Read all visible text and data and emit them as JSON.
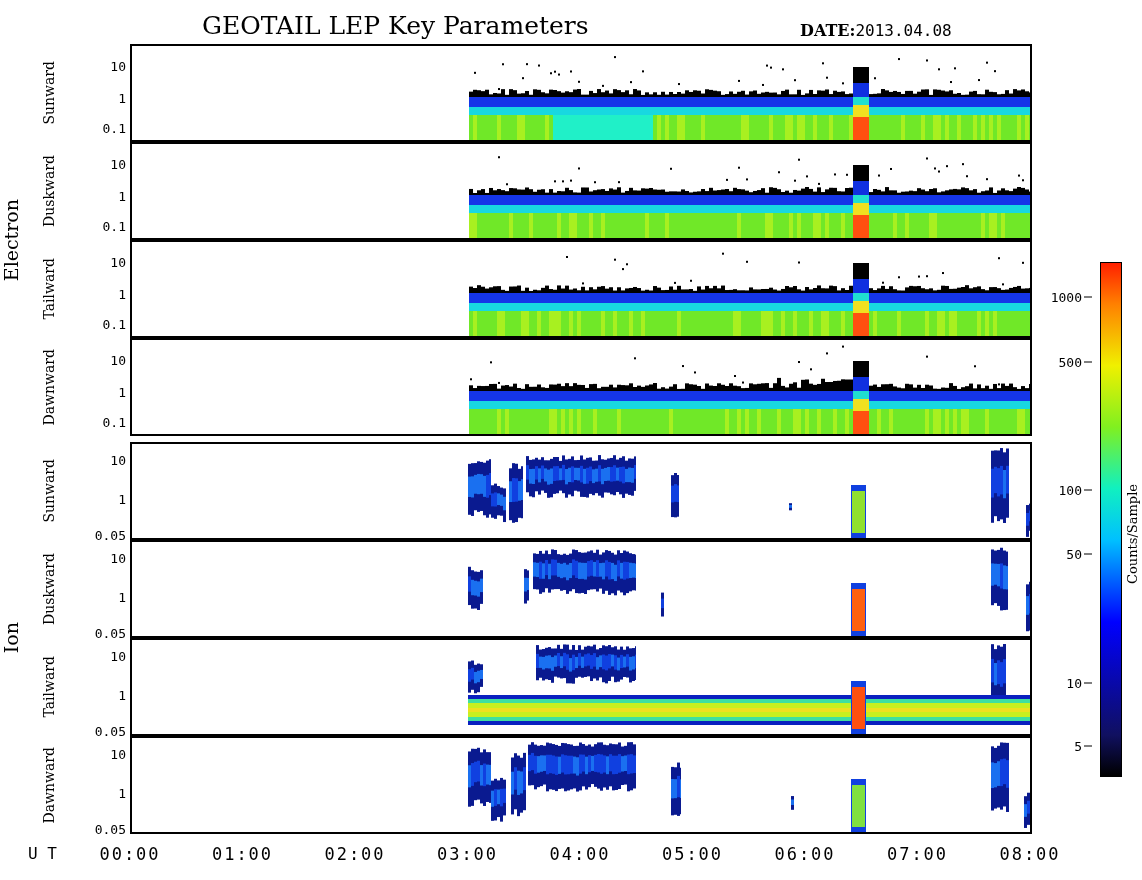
{
  "title": "GEOTAIL LEP Key Parameters",
  "date": "**DATE:**2013.04.08",
  "groups": [
    {
      "label": "Electron",
      "kind": "electron",
      "panels": [
        {
          "label": "Sunward",
          "yticks": [
            "10",
            "1",
            "0.1"
          ]
        },
        {
          "label": "Duskward",
          "yticks": [
            "10",
            "1",
            "0.1"
          ]
        },
        {
          "label": "Tailward",
          "yticks": [
            "10",
            "1",
            "0.1"
          ]
        },
        {
          "label": "Dawnward",
          "yticks": [
            "10",
            "1",
            "0.1"
          ]
        }
      ]
    },
    {
      "label": "Ion",
      "kind": "ion",
      "panels": [
        {
          "label": "Sunward",
          "yticks": [
            "10",
            "1",
            "0.05"
          ]
        },
        {
          "label": "Duskward",
          "yticks": [
            "10",
            "1",
            "0.05"
          ]
        },
        {
          "label": "Tailward",
          "yticks": [
            "10",
            "1",
            "0.05"
          ]
        },
        {
          "label": "Dawnward",
          "yticks": [
            "10",
            "1",
            "0.05"
          ]
        }
      ]
    }
  ],
  "x_axis": {
    "label": "U T",
    "ticks": [
      "00:00",
      "01:00",
      "02:00",
      "03:00",
      "04:00",
      "05:00",
      "06:00",
      "07:00",
      "08:00"
    ]
  },
  "color_scale": {
    "title": "Counts/Sample",
    "ticks": [
      "1000",
      "500",
      "100",
      "50",
      "10",
      "5"
    ]
  }
}
